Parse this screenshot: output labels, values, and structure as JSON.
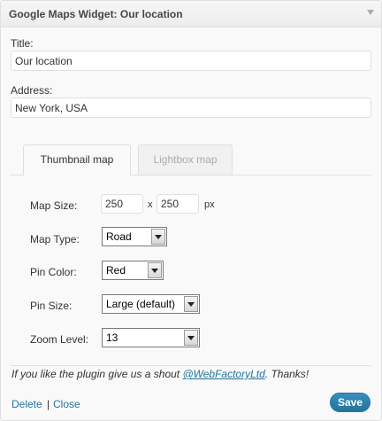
{
  "header": {
    "title_bold": "Google Maps Widget:",
    "title_sub": "Our location"
  },
  "fields": {
    "title": {
      "label": "Title:",
      "value": "Our location"
    },
    "address": {
      "label": "Address:",
      "value": "New York, USA"
    }
  },
  "tabs": [
    {
      "label": "Thumbnail map",
      "active": true
    },
    {
      "label": "Lightbox map",
      "active": false
    }
  ],
  "thumbnail": {
    "map_size": {
      "label": "Map Size:",
      "width": "250",
      "height": "250",
      "separator": "x",
      "unit": "px"
    },
    "map_type": {
      "label": "Map Type:",
      "selected": "Road"
    },
    "pin_color": {
      "label": "Pin Color:",
      "selected": "Red"
    },
    "pin_size": {
      "label": "Pin Size:",
      "selected": "Large (default)"
    },
    "zoom_level": {
      "label": "Zoom Level:",
      "selected": "13"
    }
  },
  "footnote": {
    "prefix": "If you like the plugin give us a shout ",
    "link": "@WebFactoryLtd",
    "suffix": ". Thanks!"
  },
  "footer": {
    "delete": "Delete",
    "separator": "|",
    "close": "Close",
    "save": "Save"
  }
}
